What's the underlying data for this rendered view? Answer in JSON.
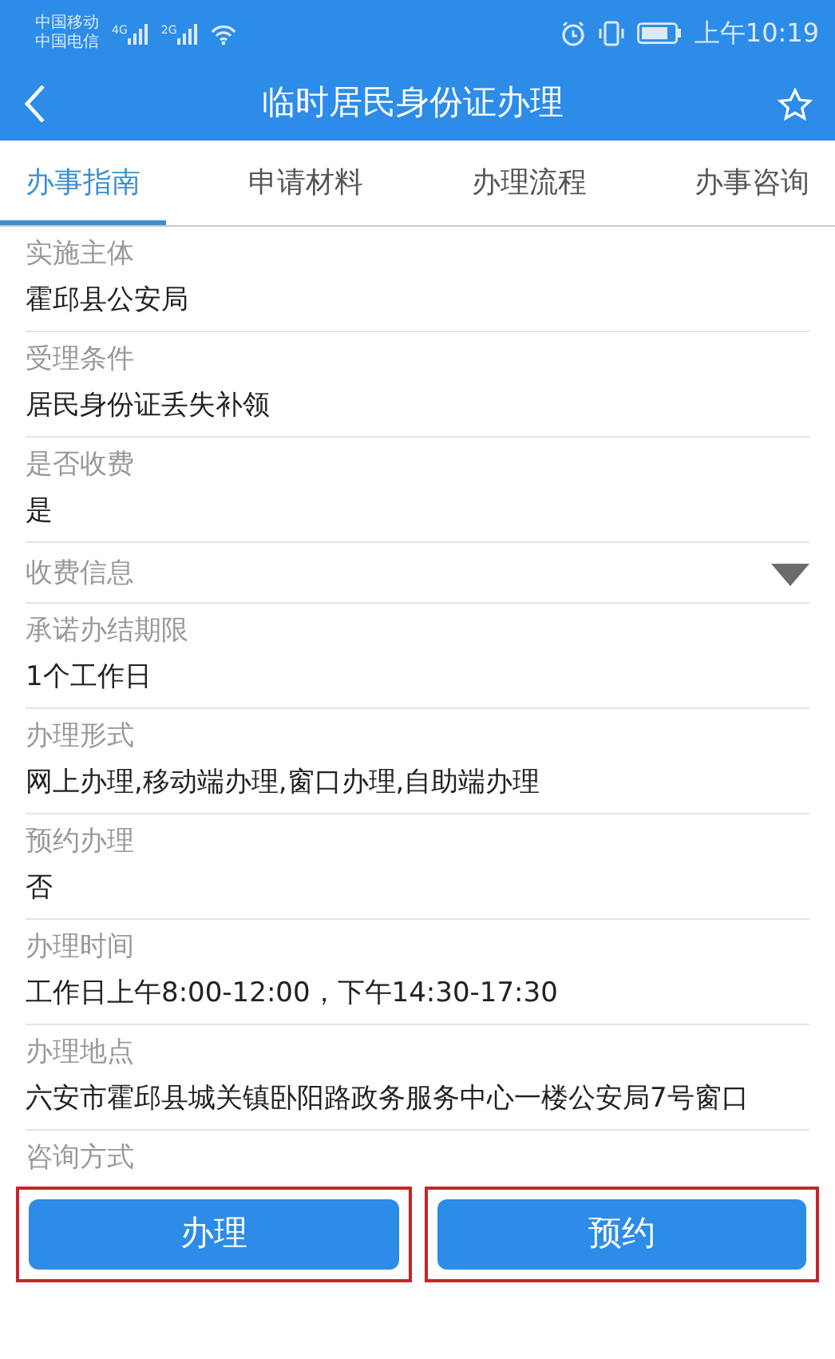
{
  "status_bar": {
    "carriers": [
      "中国移动",
      "中国电信"
    ],
    "network_labels": [
      "4G",
      "2G"
    ],
    "time": "上午10:19"
  },
  "header": {
    "title": "临时居民身份证办理",
    "favorite": false
  },
  "tabs": [
    {
      "label": "办事指南",
      "selected": true
    },
    {
      "label": "申请材料",
      "selected": false
    },
    {
      "label": "办理流程",
      "selected": false
    },
    {
      "label": "办事咨询",
      "selected": false
    }
  ],
  "fields": [
    {
      "kind": "field",
      "label": "实施主体",
      "value": "霍邱县公安局"
    },
    {
      "kind": "field",
      "label": "受理条件",
      "value": "居民身份证丢失补领"
    },
    {
      "kind": "field",
      "label": "是否收费",
      "value": "是"
    },
    {
      "kind": "dropdown",
      "label": "收费信息",
      "expanded": false
    },
    {
      "kind": "field",
      "label": "承诺办结期限",
      "value": "1个工作日"
    },
    {
      "kind": "field",
      "label": "办理形式",
      "value": "网上办理,移动端办理,窗口办理,自助端办理"
    },
    {
      "kind": "field",
      "label": "预约办理",
      "value": "否"
    },
    {
      "kind": "field",
      "label": "办理时间",
      "value": "工作日上午8:00-12:00，下午14:30-17:30"
    },
    {
      "kind": "field",
      "label": "办理地点",
      "value": "六安市霍邱县城关镇卧阳路政务服务中心一楼公安局7号窗口"
    },
    {
      "kind": "field",
      "label": "咨询方式"
    }
  ],
  "buttons": [
    {
      "label": "办理",
      "highlighted": true
    },
    {
      "label": "预约",
      "highlighted": true
    }
  ]
}
